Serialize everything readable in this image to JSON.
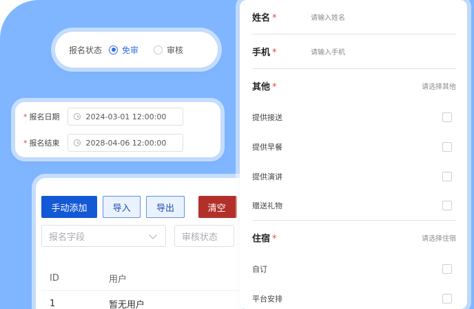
{
  "status": {
    "label": "报名状态",
    "options": [
      {
        "label": "免审",
        "selected": true
      },
      {
        "label": "审核",
        "selected": false
      }
    ]
  },
  "dates": {
    "start": {
      "label": "报名日期",
      "value": "2024-03-01 12:00:00"
    },
    "end": {
      "label": "报名结束",
      "value": "2028-04-06 12:00:00"
    }
  },
  "table": {
    "buttons": {
      "add": "手动添加",
      "import": "导入",
      "export": "导出",
      "clear": "清空"
    },
    "filters": {
      "field_placeholder": "报名字段",
      "status_placeholder": "审核状态"
    },
    "columns": [
      "ID",
      "用户"
    ],
    "rows": [
      {
        "id": "1",
        "user": "暂无用户"
      }
    ]
  },
  "form": {
    "name": {
      "label": "姓名",
      "placeholder": "请输入姓名"
    },
    "phone": {
      "label": "手机",
      "placeholder": "请输入手机"
    },
    "other": {
      "label": "其他",
      "placeholder": "请选择其他",
      "options": [
        "提供接送",
        "提供早餐",
        "提供演讲",
        "赠送礼物"
      ]
    },
    "lodging": {
      "label": "住宿",
      "placeholder": "请选择住宿",
      "options": [
        "自订",
        "平台安排"
      ]
    },
    "required_mark": "*"
  },
  "colors": {
    "background": "#80b6ff",
    "primary": "#1358d4",
    "danger": "#b3302a",
    "required": "#e0443a"
  }
}
